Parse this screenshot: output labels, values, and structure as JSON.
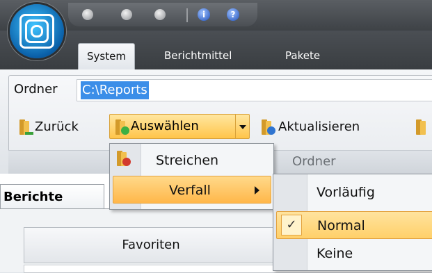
{
  "ribbon": {
    "tabs": [
      {
        "label": "System",
        "active": true
      },
      {
        "label": "Berichtmittel",
        "active": false
      },
      {
        "label": "Pakete",
        "active": false
      }
    ],
    "folder_label": "Ordner",
    "folder_value": "C:\\Reports",
    "buttons": {
      "back": "Zurück",
      "select": "Auswählen",
      "refresh": "Aktualisieren"
    },
    "group_label": "Ordner"
  },
  "dropdown": {
    "items": [
      {
        "label": "Streichen"
      },
      {
        "label": "Verfall"
      }
    ]
  },
  "submenu": {
    "items": [
      {
        "label": "Vorläufig",
        "checked": false
      },
      {
        "label": "Normal",
        "checked": true
      },
      {
        "label": "Keine",
        "checked": false
      }
    ],
    "check_glyph": "✓"
  },
  "panel": {
    "tab_label": "Berichte",
    "favorites_button": "Favoriten"
  },
  "quick_access": {
    "info_glyph": "i",
    "help_glyph": "?"
  },
  "colors": {
    "accent_orange": "#ffc54a",
    "selection_blue": "#3b8ee8",
    "titlebar_dark": "#3e4246"
  }
}
